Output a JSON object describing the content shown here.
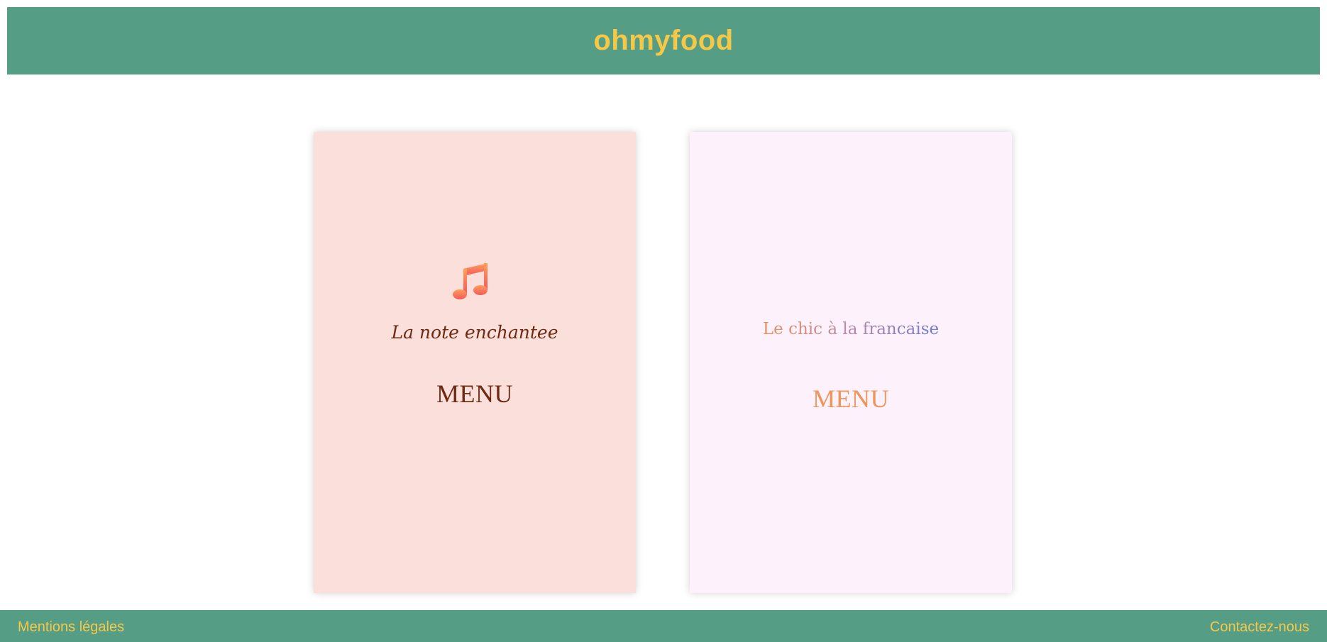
{
  "header": {
    "brand": "ohmyfood"
  },
  "restaurants": [
    {
      "name": "La note enchantee",
      "menu_label": "MENU",
      "icon": "music-note-icon",
      "background": "#fadfdb",
      "text_color": "#6e2a12",
      "icon_gradient": [
        "#ff9f5a",
        "#f3585c"
      ]
    },
    {
      "name": "Le chic à la francaise",
      "menu_label": "MENU",
      "background": "#fdf2fb",
      "menu_color": "#f0955a",
      "name_gradient": [
        "#ea9259",
        "#b987a8",
        "#6b78d9"
      ]
    }
  ],
  "footer": {
    "left_link": "Mentions légales",
    "right_link": "Contactez-nous"
  },
  "colors": {
    "brand_bar": "#569d86",
    "brand_text": "#f6c847"
  }
}
